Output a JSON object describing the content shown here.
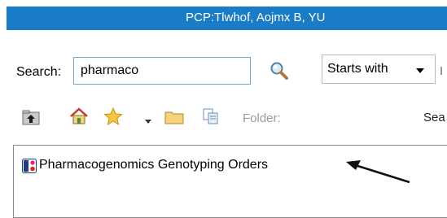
{
  "window": {
    "title": "PCP:Tlwhof, Aojmx B, YU",
    "accent_color": "#1a7bc6"
  },
  "search": {
    "label": "Search:",
    "value": "pharmaco",
    "mode": {
      "selected": "Starts with"
    },
    "button_icon": "magnifier-icon"
  },
  "toolbar": {
    "icons": [
      "up-folder-icon",
      "home-icon",
      "favorites-star-icon",
      "dropdown-arrow-icon",
      "folder-icon",
      "copy-icon"
    ],
    "folder_label": "Folder:",
    "search_truncated_label": "Sea"
  },
  "results": {
    "items": [
      {
        "label": "Pharmacogenomics Genotyping Orders",
        "icon": "order-set-icon"
      }
    ]
  },
  "annotation": {
    "icon": "arrow-icon",
    "color": "#111111"
  }
}
